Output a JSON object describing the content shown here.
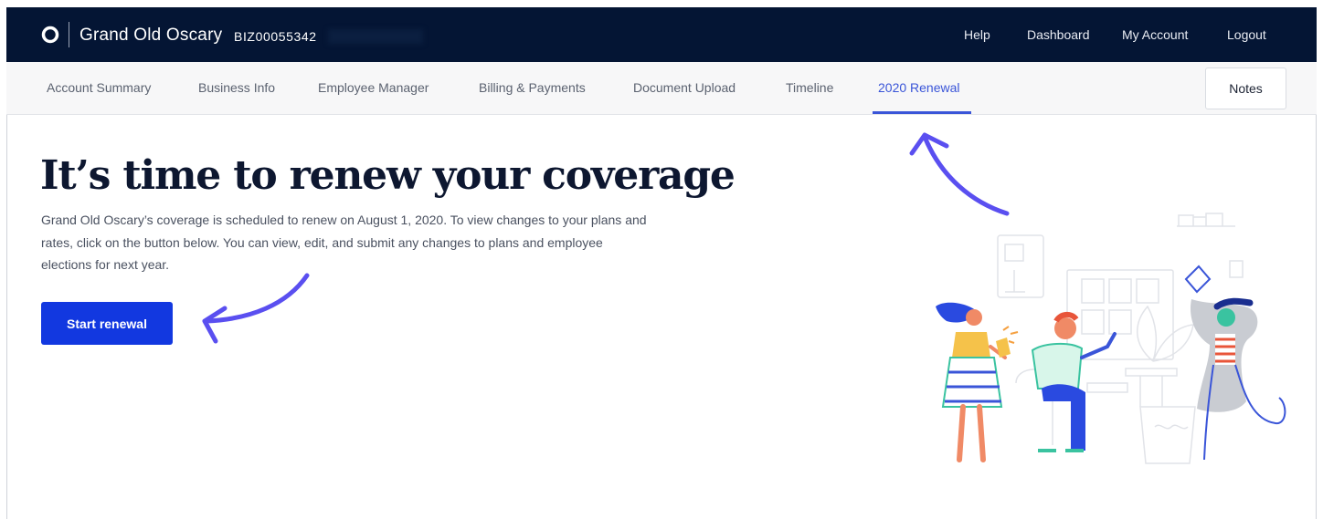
{
  "header": {
    "logo_icon": "circle-logo-icon",
    "brand": "Grand Old Oscary",
    "business_id": "BIZ00055342",
    "nav": [
      {
        "label": "Help"
      },
      {
        "label": "Dashboard"
      },
      {
        "label": "My Account"
      },
      {
        "label": "Logout"
      }
    ]
  },
  "tabs": [
    {
      "label": "Account Summary"
    },
    {
      "label": "Business Info"
    },
    {
      "label": "Employee Manager"
    },
    {
      "label": "Billing & Payments"
    },
    {
      "label": "Document Upload"
    },
    {
      "label": "Timeline"
    },
    {
      "label": "2020 Renewal",
      "active": true
    }
  ],
  "notes_label": "Notes",
  "main": {
    "headline": "It’s time to renew your coverage",
    "description": "Grand Old Oscary’s coverage is scheduled to renew on August 1, 2020. To view changes to your plans and rates, click on the button below. You can view, edit, and submit any changes to plans and employee elections for next year.",
    "button_label": "Start renewal"
  },
  "colors": {
    "header_bg": "#041534",
    "accent": "#1238e0",
    "active_tab": "#3a55d8",
    "annotation_arrow": "#5a4ff0"
  }
}
